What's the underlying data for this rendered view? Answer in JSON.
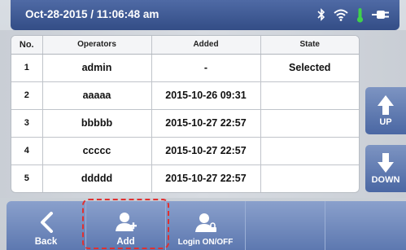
{
  "status_bar": {
    "datetime": "Oct-28-2015 / 11:06:48 am",
    "icons": [
      "bluetooth-icon",
      "wifi-icon",
      "thermometer-icon",
      "battery-plug-icon"
    ],
    "thermometer_color": "#3fd24a"
  },
  "table": {
    "headers": {
      "no": "No.",
      "operators": "Operators",
      "added": "Added",
      "state": "State"
    },
    "rows": [
      {
        "no": "1",
        "operator": "admin",
        "added": "-",
        "state": "Selected"
      },
      {
        "no": "2",
        "operator": "aaaaa",
        "added": "2015-10-26 09:31",
        "state": ""
      },
      {
        "no": "3",
        "operator": "bbbbb",
        "added": "2015-10-27 22:57",
        "state": ""
      },
      {
        "no": "4",
        "operator": "ccccc",
        "added": "2015-10-27 22:57",
        "state": ""
      },
      {
        "no": "5",
        "operator": "ddddd",
        "added": "2015-10-27 22:57",
        "state": ""
      }
    ]
  },
  "side": {
    "up_label": "UP",
    "down_label": "DOWN"
  },
  "toolbar": {
    "back_label": "Back",
    "add_label": "Add",
    "login_label": "Login ON/OFF"
  },
  "colors": {
    "accent": "#4a67a3",
    "highlight": "#e03030"
  }
}
